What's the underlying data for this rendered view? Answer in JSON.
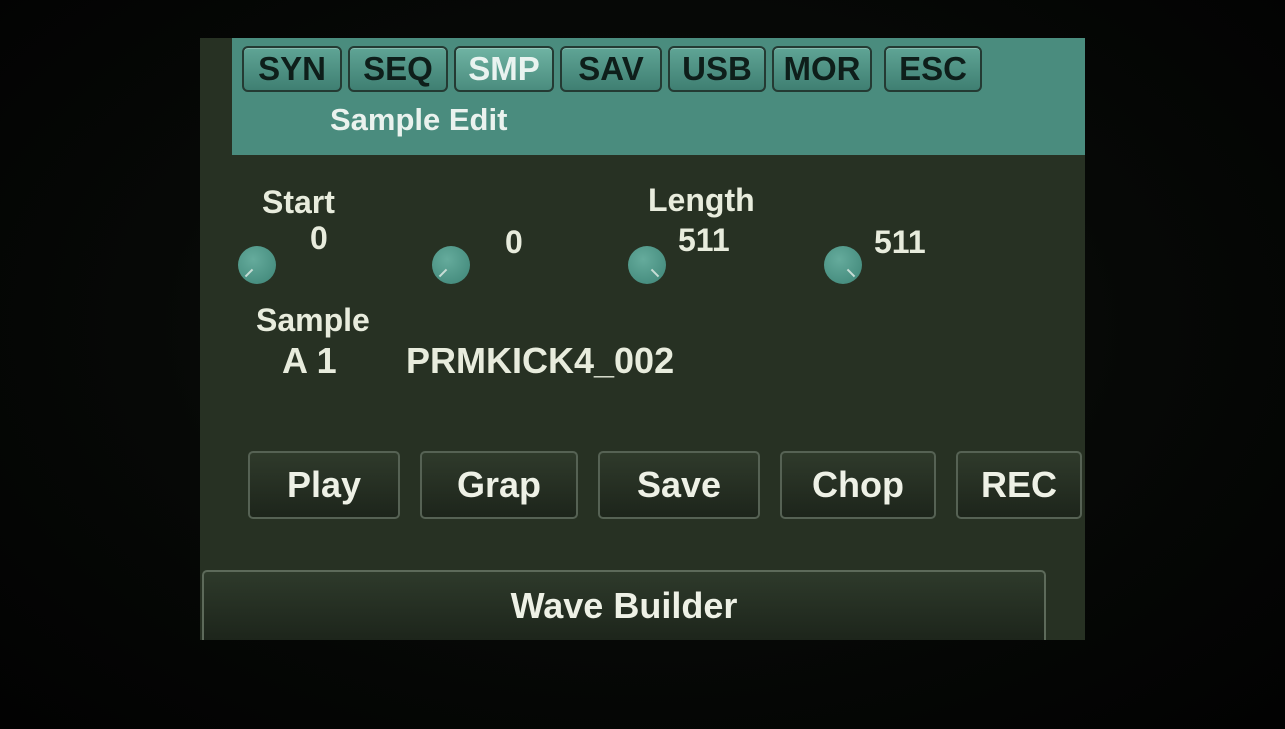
{
  "tabs": [
    {
      "label": "SYN",
      "active": false
    },
    {
      "label": "SEQ",
      "active": false
    },
    {
      "label": "SMP",
      "active": true
    },
    {
      "label": "SAV",
      "active": false
    },
    {
      "label": "USB",
      "active": false
    },
    {
      "label": "MOR",
      "active": false
    },
    {
      "label": "ESC",
      "active": false
    }
  ],
  "header": {
    "title": "Sample Edit"
  },
  "params": {
    "start_label": "Start",
    "length_label": "Length",
    "values": [
      "0",
      "0",
      "511",
      "511"
    ]
  },
  "sample": {
    "label": "Sample",
    "bank": "A 1",
    "name": "PRMKICK4_002"
  },
  "buttons": {
    "play": "Play",
    "graph": "Grap",
    "save": "Save",
    "chop": "Chop",
    "rec": "REC"
  },
  "wave_builder": "Wave Builder",
  "colors": {
    "header_bg": "#4a8c7e",
    "screen_bg": "#273123",
    "knob": "#4f9686",
    "text": "#e8ecdd"
  }
}
